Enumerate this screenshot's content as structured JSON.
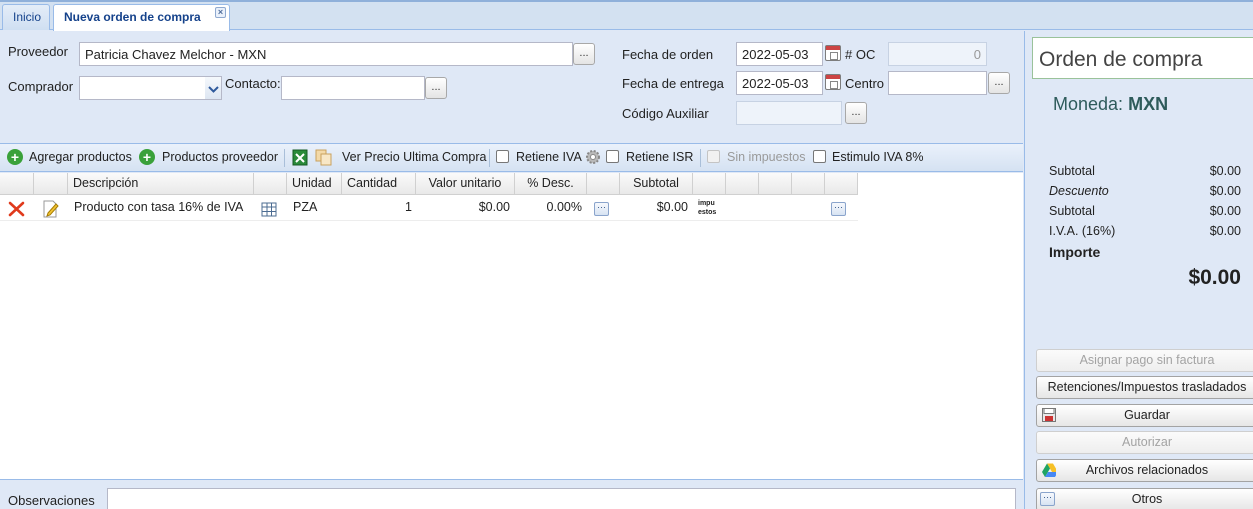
{
  "tabs": {
    "home": "Inicio",
    "active": "Nueva orden de compra"
  },
  "form": {
    "proveedor_label": "Proveedor",
    "proveedor_value": "Patricia Chavez Melchor - MXN",
    "comprador_label": "Comprador",
    "comprador_value": "",
    "contacto_label": "Contacto:",
    "contacto_value": "",
    "fecha_orden_label": "Fecha de orden",
    "fecha_orden_value": "2022-05-03",
    "oc_label": "# OC",
    "oc_value": "0",
    "fecha_entrega_label": "Fecha de entrega",
    "fecha_entrega_value": "2022-05-03",
    "centro_label": "Centro",
    "centro_value": "",
    "codigo_aux_label": "Código Auxiliar",
    "codigo_aux_value": "",
    "dots_label": "..."
  },
  "toolbar": {
    "agregar": "Agregar productos",
    "proveedor": "Productos proveedor",
    "ver_precio": "Ver Precio Ultima Compra",
    "retiene_iva": "Retiene IVA",
    "retiene_isr": "Retiene ISR",
    "sin_impuestos": "Sin impuestos",
    "estimulo": "Estimulo IVA 8%"
  },
  "grid": {
    "headers": [
      "Descripción",
      "Unidad",
      "Cantidad",
      "Valor unitario",
      "% Desc.",
      "Subtotal"
    ],
    "row": {
      "descripcion": "Producto con tasa 16% de IVA",
      "unidad": "PZA",
      "cantidad": "1",
      "valor_unitario": "$0.00",
      "descuento": "0.00%",
      "subtotal": "$0.00",
      "impuestos_line1": "impu",
      "impuestos_line2": "estos"
    }
  },
  "observaciones_label": "Observaciones",
  "panel": {
    "title": "Orden de compra",
    "moneda_label": "Moneda:",
    "moneda_value": "MXN",
    "subtotal_label": "Subtotal",
    "subtotal_value": "$0.00",
    "descuento_label": "Descuento",
    "descuento_value": "$0.00",
    "subtotal2_label": "Subtotal",
    "subtotal2_value": "$0.00",
    "iva_label": "I.V.A. (16%)",
    "iva_value": "$0.00",
    "importe_label": "Importe",
    "importe_value": "$0.00",
    "buttons": {
      "asignar": "Asignar pago sin factura",
      "retenciones": "Retenciones/Impuestos trasladados",
      "guardar": "Guardar",
      "autorizar": "Autorizar",
      "archivos": "Archivos relacionados",
      "otros": "Otros"
    }
  }
}
